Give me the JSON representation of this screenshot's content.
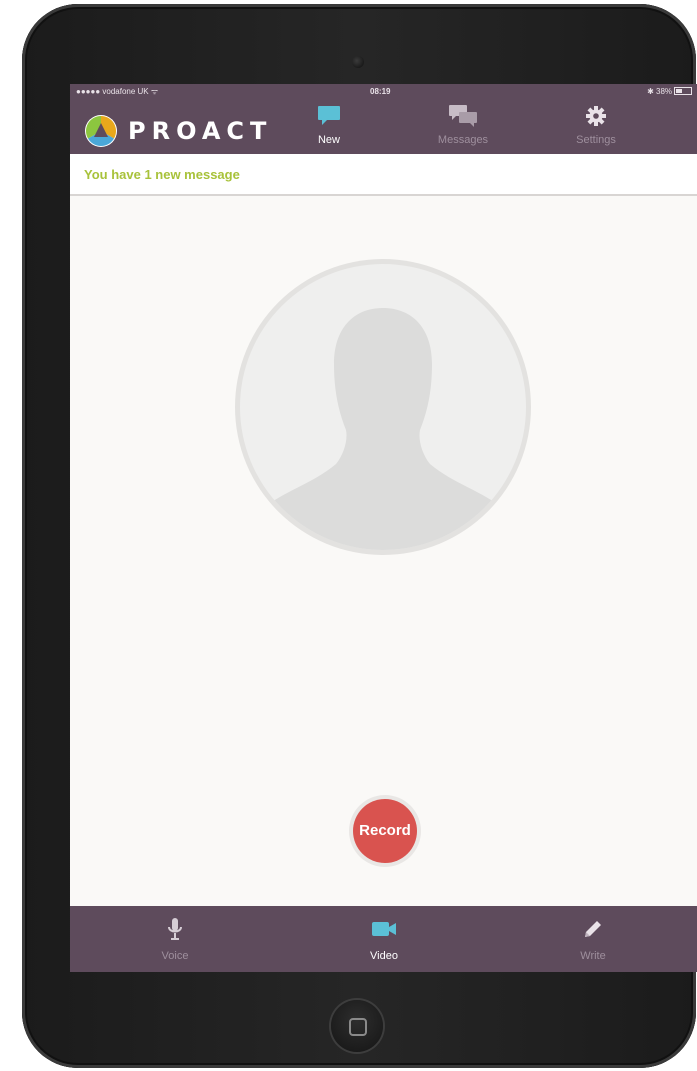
{
  "status_bar": {
    "carrier": "●●●●● vodafone UK ᯤ",
    "time": "08:19",
    "battery": "✱ 38%"
  },
  "app": {
    "logo_text": "PROACT"
  },
  "top_nav": [
    {
      "label": "New",
      "icon": "speech-bubble-icon",
      "active": true
    },
    {
      "label": "Messages",
      "icon": "chat-bubbles-icon",
      "active": false
    },
    {
      "label": "Settings",
      "icon": "gear-icon",
      "active": false
    }
  ],
  "notification": {
    "text": "You have 1 new message"
  },
  "record": {
    "label": "Record"
  },
  "bottom_nav": [
    {
      "label": "Voice",
      "icon": "microphone-icon",
      "active": false
    },
    {
      "label": "Video",
      "icon": "video-camera-icon",
      "active": true
    },
    {
      "label": "Write",
      "icon": "pencil-icon",
      "active": false
    }
  ],
  "colors": {
    "header": "#5e4b5c",
    "accent_active": "#5bc0d6",
    "notification_text": "#a8c23a",
    "record": "#d9534f"
  }
}
